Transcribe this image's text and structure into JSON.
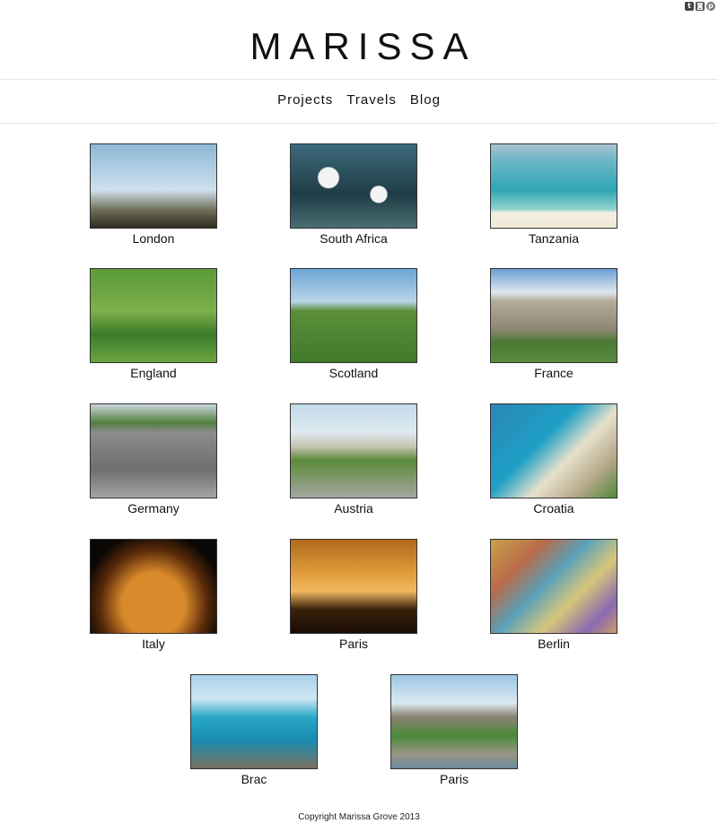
{
  "site": {
    "title": "MARISSA",
    "social_icons": [
      "tumblr-icon",
      "instagram-icon",
      "pinterest-icon"
    ]
  },
  "nav": {
    "items": [
      "Projects",
      "Travels",
      "Blog"
    ]
  },
  "gallery": {
    "items": [
      {
        "label": "London"
      },
      {
        "label": "South Africa"
      },
      {
        "label": "Tanzania"
      },
      {
        "label": "England"
      },
      {
        "label": "Scotland"
      },
      {
        "label": "France"
      },
      {
        "label": "Germany"
      },
      {
        "label": "Austria"
      },
      {
        "label": "Croatia"
      },
      {
        "label": "Italy"
      },
      {
        "label": "Paris"
      },
      {
        "label": "Berlin"
      },
      {
        "label": "Brac"
      },
      {
        "label": "Paris"
      }
    ]
  },
  "footer": {
    "copyright": "Copyright Marissa Grove 2013"
  }
}
